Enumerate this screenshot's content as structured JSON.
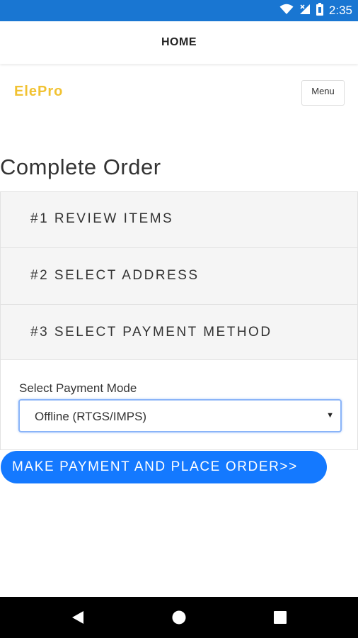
{
  "status_bar": {
    "time": "2:35",
    "icons": [
      "wifi-icon",
      "signal-icon",
      "battery-icon"
    ]
  },
  "app_bar": {
    "title": "HOME"
  },
  "header": {
    "brand": "ElePro",
    "menu_label": "Menu"
  },
  "page": {
    "title": "Complete Order"
  },
  "steps": [
    {
      "label": "#1 REVIEW ITEMS"
    },
    {
      "label": "#2 SELECT ADDRESS"
    },
    {
      "label": "#3 SELECT PAYMENT METHOD"
    }
  ],
  "payment": {
    "label": "Select Payment Mode",
    "selected": "Offline (RTGS/IMPS)"
  },
  "cta": {
    "label": "MAKE PAYMENT AND PLACE ORDER>>"
  },
  "nav": {
    "icons": [
      "back-icon",
      "home-icon",
      "recents-icon"
    ]
  },
  "colors": {
    "status_bar": "#1976d2",
    "brand": "#f1c232",
    "cta": "#1479ff",
    "select_border": "#8ab4f8"
  }
}
